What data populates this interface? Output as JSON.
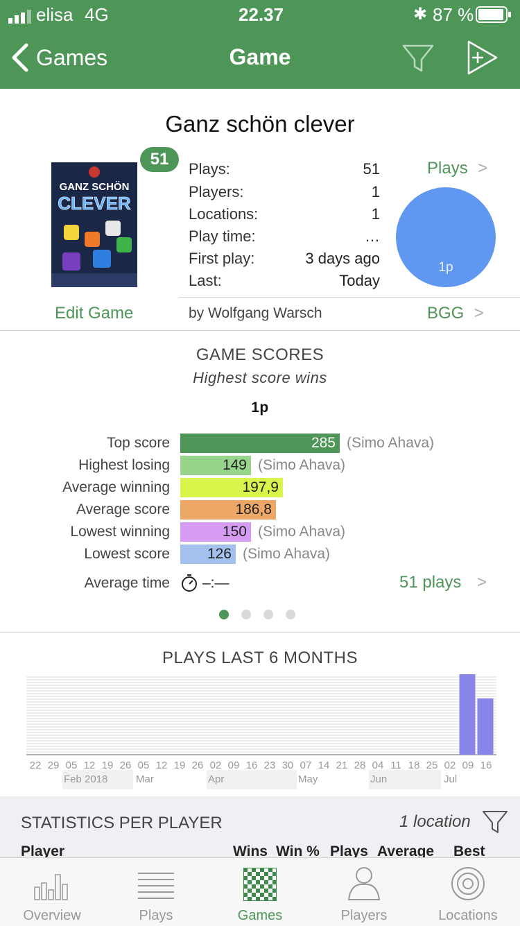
{
  "status_bar": {
    "carrier": "elisa",
    "network": "4G",
    "time": "22.37",
    "battery": "87 %"
  },
  "nav": {
    "back_label": "Games",
    "title": "Game"
  },
  "game": {
    "title": "Ganz schön clever",
    "badge": "51",
    "cover_text_line1": "GANZ SCHÖN",
    "cover_text_line2": "CLEVER",
    "stats": [
      {
        "label": "Plays:",
        "value": "51"
      },
      {
        "label": "Players:",
        "value": "1"
      },
      {
        "label": "Locations:",
        "value": "1"
      },
      {
        "label": "Play time:",
        "value": "…"
      },
      {
        "label": "First play:",
        "value": "3 days ago"
      },
      {
        "label": "Last:",
        "value": "Today"
      }
    ],
    "plays_link": "Plays",
    "pie_label": "1p",
    "edit_label": "Edit Game",
    "designer": "by Wolfgang Warsch",
    "bgg_link": "BGG"
  },
  "scores": {
    "heading": "GAME SCORES",
    "subheading": "Highest score wins",
    "group": "1p",
    "rows": [
      {
        "label": "Top score",
        "value": "285",
        "who": "(Simo Ahava)",
        "color": "#4e9658",
        "text_color": "#ffffff"
      },
      {
        "label": "Highest losing",
        "value": "149",
        "who": "(Simo Ahava)",
        "color": "#97d58c",
        "text_color": "#222222"
      },
      {
        "label": "Average winning",
        "value": "197,9",
        "who": "",
        "color": "#d9f54c",
        "text_color": "#222222"
      },
      {
        "label": "Average score",
        "value": "186,8",
        "who": "",
        "color": "#eda767",
        "text_color": "#222222"
      },
      {
        "label": "Lowest winning",
        "value": "150",
        "who": "(Simo Ahava)",
        "color": "#d69bf3",
        "text_color": "#222222"
      },
      {
        "label": "Lowest score",
        "value": "126",
        "who": "(Simo Ahava)",
        "color": "#a4c0ec",
        "text_color": "#222222"
      }
    ],
    "avg_time_label": "Average time",
    "avg_time_value": "–:—",
    "plays_link": "51 plays"
  },
  "chart_data": {
    "type": "bar",
    "title": "PLAYS LAST 6 MONTHS",
    "x": [
      "22",
      "29",
      "05",
      "12",
      "19",
      "26",
      "05",
      "12",
      "19",
      "26",
      "02",
      "09",
      "16",
      "23",
      "30",
      "07",
      "14",
      "21",
      "28",
      "04",
      "11",
      "18",
      "25",
      "02",
      "09",
      "16"
    ],
    "months": [
      "Feb 2018",
      "Mar",
      "Apr",
      "May",
      "Jun",
      "Jul"
    ],
    "values": [
      0,
      0,
      0,
      0,
      0,
      0,
      0,
      0,
      0,
      0,
      0,
      0,
      0,
      0,
      0,
      0,
      0,
      0,
      0,
      0,
      0,
      0,
      0,
      0,
      30,
      21
    ],
    "ylim": [
      0,
      30
    ],
    "bar_color": "#8a86e8"
  },
  "stats_per_player": {
    "heading": "STATISTICS PER PLAYER",
    "location_filter": "1 location",
    "columns": [
      "Player",
      "Wins",
      "Win %",
      "Plays",
      "Average",
      "Best"
    ]
  },
  "tabs": [
    {
      "label": "Overview",
      "icon": "bar-chart-icon"
    },
    {
      "label": "Plays",
      "icon": "list-icon"
    },
    {
      "label": "Games",
      "icon": "checkerboard-icon",
      "active": true
    },
    {
      "label": "Players",
      "icon": "person-icon"
    },
    {
      "label": "Locations",
      "icon": "target-icon"
    }
  ]
}
